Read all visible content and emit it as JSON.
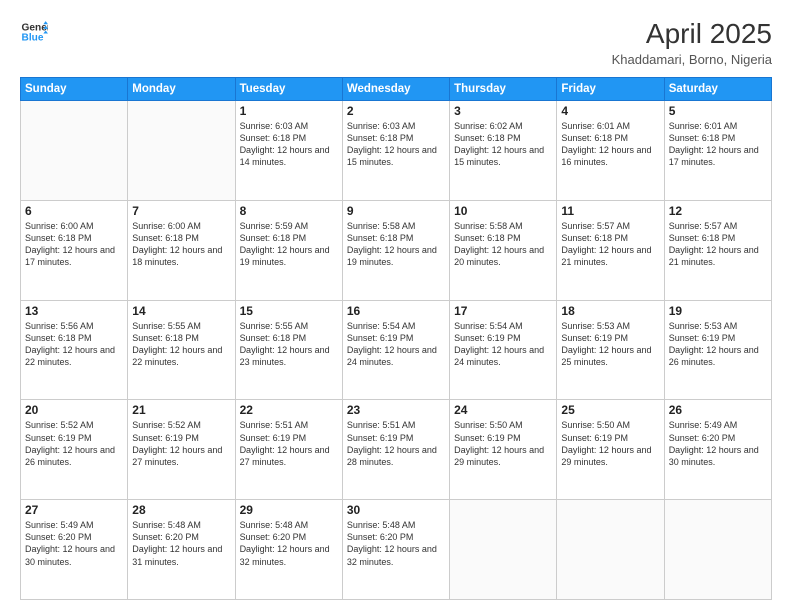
{
  "header": {
    "logo_line1": "General",
    "logo_line2": "Blue",
    "month_title": "April 2025",
    "location": "Khaddamari, Borno, Nigeria"
  },
  "days_of_week": [
    "Sunday",
    "Monday",
    "Tuesday",
    "Wednesday",
    "Thursday",
    "Friday",
    "Saturday"
  ],
  "weeks": [
    [
      {
        "num": "",
        "info": ""
      },
      {
        "num": "",
        "info": ""
      },
      {
        "num": "1",
        "info": "Sunrise: 6:03 AM\nSunset: 6:18 PM\nDaylight: 12 hours and 14 minutes."
      },
      {
        "num": "2",
        "info": "Sunrise: 6:03 AM\nSunset: 6:18 PM\nDaylight: 12 hours and 15 minutes."
      },
      {
        "num": "3",
        "info": "Sunrise: 6:02 AM\nSunset: 6:18 PM\nDaylight: 12 hours and 15 minutes."
      },
      {
        "num": "4",
        "info": "Sunrise: 6:01 AM\nSunset: 6:18 PM\nDaylight: 12 hours and 16 minutes."
      },
      {
        "num": "5",
        "info": "Sunrise: 6:01 AM\nSunset: 6:18 PM\nDaylight: 12 hours and 17 minutes."
      }
    ],
    [
      {
        "num": "6",
        "info": "Sunrise: 6:00 AM\nSunset: 6:18 PM\nDaylight: 12 hours and 17 minutes."
      },
      {
        "num": "7",
        "info": "Sunrise: 6:00 AM\nSunset: 6:18 PM\nDaylight: 12 hours and 18 minutes."
      },
      {
        "num": "8",
        "info": "Sunrise: 5:59 AM\nSunset: 6:18 PM\nDaylight: 12 hours and 19 minutes."
      },
      {
        "num": "9",
        "info": "Sunrise: 5:58 AM\nSunset: 6:18 PM\nDaylight: 12 hours and 19 minutes."
      },
      {
        "num": "10",
        "info": "Sunrise: 5:58 AM\nSunset: 6:18 PM\nDaylight: 12 hours and 20 minutes."
      },
      {
        "num": "11",
        "info": "Sunrise: 5:57 AM\nSunset: 6:18 PM\nDaylight: 12 hours and 21 minutes."
      },
      {
        "num": "12",
        "info": "Sunrise: 5:57 AM\nSunset: 6:18 PM\nDaylight: 12 hours and 21 minutes."
      }
    ],
    [
      {
        "num": "13",
        "info": "Sunrise: 5:56 AM\nSunset: 6:18 PM\nDaylight: 12 hours and 22 minutes."
      },
      {
        "num": "14",
        "info": "Sunrise: 5:55 AM\nSunset: 6:18 PM\nDaylight: 12 hours and 22 minutes."
      },
      {
        "num": "15",
        "info": "Sunrise: 5:55 AM\nSunset: 6:18 PM\nDaylight: 12 hours and 23 minutes."
      },
      {
        "num": "16",
        "info": "Sunrise: 5:54 AM\nSunset: 6:19 PM\nDaylight: 12 hours and 24 minutes."
      },
      {
        "num": "17",
        "info": "Sunrise: 5:54 AM\nSunset: 6:19 PM\nDaylight: 12 hours and 24 minutes."
      },
      {
        "num": "18",
        "info": "Sunrise: 5:53 AM\nSunset: 6:19 PM\nDaylight: 12 hours and 25 minutes."
      },
      {
        "num": "19",
        "info": "Sunrise: 5:53 AM\nSunset: 6:19 PM\nDaylight: 12 hours and 26 minutes."
      }
    ],
    [
      {
        "num": "20",
        "info": "Sunrise: 5:52 AM\nSunset: 6:19 PM\nDaylight: 12 hours and 26 minutes."
      },
      {
        "num": "21",
        "info": "Sunrise: 5:52 AM\nSunset: 6:19 PM\nDaylight: 12 hours and 27 minutes."
      },
      {
        "num": "22",
        "info": "Sunrise: 5:51 AM\nSunset: 6:19 PM\nDaylight: 12 hours and 27 minutes."
      },
      {
        "num": "23",
        "info": "Sunrise: 5:51 AM\nSunset: 6:19 PM\nDaylight: 12 hours and 28 minutes."
      },
      {
        "num": "24",
        "info": "Sunrise: 5:50 AM\nSunset: 6:19 PM\nDaylight: 12 hours and 29 minutes."
      },
      {
        "num": "25",
        "info": "Sunrise: 5:50 AM\nSunset: 6:19 PM\nDaylight: 12 hours and 29 minutes."
      },
      {
        "num": "26",
        "info": "Sunrise: 5:49 AM\nSunset: 6:20 PM\nDaylight: 12 hours and 30 minutes."
      }
    ],
    [
      {
        "num": "27",
        "info": "Sunrise: 5:49 AM\nSunset: 6:20 PM\nDaylight: 12 hours and 30 minutes."
      },
      {
        "num": "28",
        "info": "Sunrise: 5:48 AM\nSunset: 6:20 PM\nDaylight: 12 hours and 31 minutes."
      },
      {
        "num": "29",
        "info": "Sunrise: 5:48 AM\nSunset: 6:20 PM\nDaylight: 12 hours and 32 minutes."
      },
      {
        "num": "30",
        "info": "Sunrise: 5:48 AM\nSunset: 6:20 PM\nDaylight: 12 hours and 32 minutes."
      },
      {
        "num": "",
        "info": ""
      },
      {
        "num": "",
        "info": ""
      },
      {
        "num": "",
        "info": ""
      }
    ]
  ]
}
